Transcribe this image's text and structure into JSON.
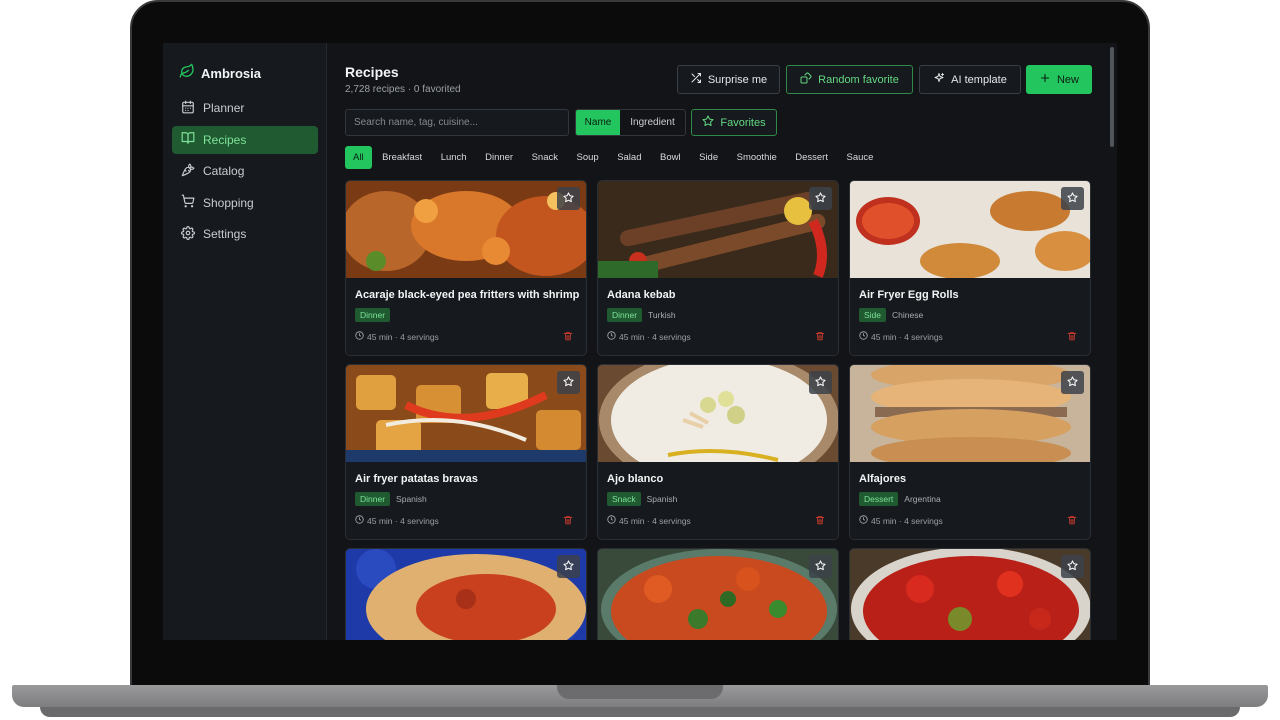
{
  "app": {
    "name": "Ambrosia"
  },
  "nav": [
    {
      "label": "Planner",
      "icon": "calendar-icon",
      "active": false
    },
    {
      "label": "Recipes",
      "icon": "book-icon",
      "active": true
    },
    {
      "label": "Catalog",
      "icon": "carrot-icon",
      "active": false
    },
    {
      "label": "Shopping",
      "icon": "cart-icon",
      "active": false
    },
    {
      "label": "Settings",
      "icon": "gear-icon",
      "active": false
    }
  ],
  "header": {
    "title": "Recipes",
    "subtitle": "2,728 recipes · 0 favorited",
    "surprise_label": "Surprise me",
    "random_favorite_label": "Random favorite",
    "ai_template_label": "AI template",
    "new_label": "New"
  },
  "search": {
    "placeholder": "Search name, tag, cuisine...",
    "value": ""
  },
  "search_mode": {
    "name_label": "Name",
    "ingredient_label": "Ingredient",
    "selected": "Name"
  },
  "favorites_label": "Favorites",
  "categories": [
    "All",
    "Breakfast",
    "Lunch",
    "Dinner",
    "Snack",
    "Soup",
    "Salad",
    "Bowl",
    "Side",
    "Smoothie",
    "Dessert",
    "Sauce"
  ],
  "selected_category": "All",
  "recipes": [
    {
      "title": "Acaraje black-eyed pea fritters with shrimp",
      "tag": "Dinner",
      "cuisine": "",
      "meta": "45 min · 4 servings"
    },
    {
      "title": "Adana kebab",
      "tag": "Dinner",
      "cuisine": "Turkish",
      "meta": "45 min · 4 servings"
    },
    {
      "title": "Air Fryer Egg Rolls",
      "tag": "Side",
      "cuisine": "Chinese",
      "meta": "45 min · 4 servings"
    },
    {
      "title": "Air fryer patatas bravas",
      "tag": "Dinner",
      "cuisine": "Spanish",
      "meta": "45 min · 4 servings"
    },
    {
      "title": "Ajo blanco",
      "tag": "Snack",
      "cuisine": "Spanish",
      "meta": "45 min · 4 servings"
    },
    {
      "title": "Alfajores",
      "tag": "Dessert",
      "cuisine": "Argentina",
      "meta": "45 min · 4 servings"
    },
    {
      "title": "",
      "tag": "",
      "cuisine": "",
      "meta": ""
    },
    {
      "title": "",
      "tag": "",
      "cuisine": "",
      "meta": ""
    },
    {
      "title": "",
      "tag": "",
      "cuisine": "",
      "meta": ""
    }
  ],
  "colors": {
    "accent": "#22c55e",
    "accent_dark": "#1f5a30",
    "background": "#121417",
    "danger": "#c0392b"
  }
}
